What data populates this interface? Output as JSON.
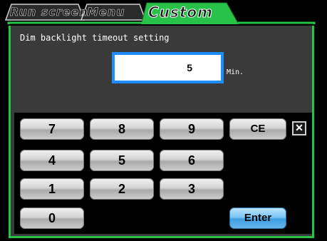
{
  "tabs": [
    {
      "label": "Run screen"
    },
    {
      "label": "Menu"
    },
    {
      "label": "Custom"
    }
  ],
  "setting": {
    "label": "Dim backlight timeout setting",
    "value": "5",
    "unit": "Min."
  },
  "keypad": {
    "keys": [
      "7",
      "8",
      "9",
      "CE",
      "4",
      "5",
      "6",
      "1",
      "2",
      "3",
      "0"
    ],
    "enter_label": "Enter",
    "close_symbol": "✕"
  },
  "colors": {
    "accent_green": "#28c24a",
    "input_highlight": "#1c8dff"
  },
  "icons": {
    "close": "close-icon"
  }
}
